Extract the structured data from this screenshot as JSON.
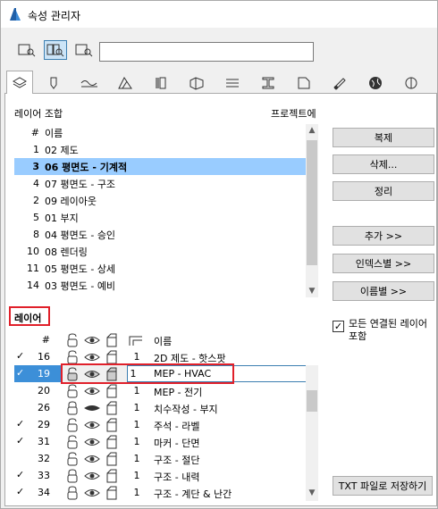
{
  "window": {
    "title": "속성 관리자"
  },
  "toolbar": {
    "search_value": ""
  },
  "combinations": {
    "label": "레이어 조합",
    "project_label": "프로젝트에",
    "header_num": "#",
    "header_name": "이름",
    "rows": [
      {
        "num": "1",
        "name": "02 제도",
        "selected": false
      },
      {
        "num": "3",
        "name": "06 평면도 - 기계적",
        "selected": true
      },
      {
        "num": "4",
        "name": "07 평면도 - 구조",
        "selected": false
      },
      {
        "num": "2",
        "name": "09 레이아웃",
        "selected": false
      },
      {
        "num": "5",
        "name": "01 부지",
        "selected": false
      },
      {
        "num": "8",
        "name": "04 평면도 - 승인",
        "selected": false
      },
      {
        "num": "10",
        "name": "08 렌더링",
        "selected": false
      },
      {
        "num": "11",
        "name": "05 평면도 - 상세",
        "selected": false
      },
      {
        "num": "14",
        "name": "03 평면도 - 예비",
        "selected": false
      }
    ]
  },
  "buttons": {
    "duplicate": "복제",
    "delete": "삭제...",
    "purge": "정리",
    "add": "추가 >>",
    "by_index": "인덱스별 >>",
    "by_name": "이름별 >>",
    "save_txt": "TXT 파일로 저장하기"
  },
  "layers": {
    "label": "레이어",
    "header_num": "#",
    "header_name": "이름",
    "include_linked_label": "모든 연결된 레이어 포함",
    "include_linked_checked": true,
    "rows": [
      {
        "checked": true,
        "num": "16",
        "pen": "1",
        "name": "2D 제도 - 핫스팟",
        "lock": false,
        "eye": "open"
      },
      {
        "checked": true,
        "num": "19",
        "pen": "1",
        "name": "MEP - HVAC",
        "lock": false,
        "eye": "open",
        "editing": true
      },
      {
        "checked": false,
        "num": "20",
        "pen": "1",
        "name": "MEP - 전기",
        "lock": false,
        "eye": "open"
      },
      {
        "checked": false,
        "num": "26",
        "pen": "1",
        "name": "치수작성 - 부지",
        "lock": true,
        "eye": "closed"
      },
      {
        "checked": true,
        "num": "29",
        "pen": "1",
        "name": "주석 - 라벨",
        "lock": false,
        "eye": "open"
      },
      {
        "checked": true,
        "num": "31",
        "pen": "1",
        "name": "마커 - 단면",
        "lock": false,
        "eye": "open"
      },
      {
        "checked": false,
        "num": "32",
        "pen": "1",
        "name": "구조 - 절단",
        "lock": false,
        "eye": "open"
      },
      {
        "checked": true,
        "num": "33",
        "pen": "1",
        "name": "구조 - 내력",
        "lock": true,
        "eye": "open"
      },
      {
        "checked": true,
        "num": "34",
        "pen": "1",
        "name": "구조 - 계단 & 난간",
        "lock": true,
        "eye": "open"
      }
    ]
  },
  "colors": {
    "selection": "#99ccff",
    "active_selection": "#3c8fd8",
    "highlight": "#e0202a"
  }
}
